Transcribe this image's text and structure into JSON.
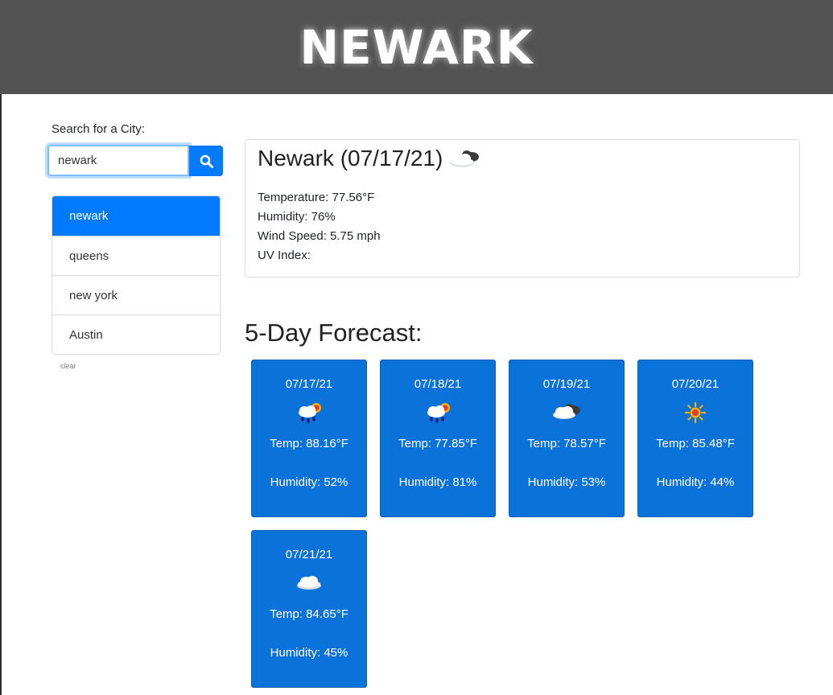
{
  "header": {
    "title": "NEWARK"
  },
  "search": {
    "label": "Search for a City:",
    "value": "newark",
    "button_icon": "search-icon"
  },
  "history": {
    "items": [
      {
        "label": "newark",
        "active": true
      },
      {
        "label": "queens",
        "active": false
      },
      {
        "label": "new york",
        "active": false
      },
      {
        "label": "Austin",
        "active": false
      }
    ],
    "clear_label": "clear"
  },
  "current": {
    "title": "Newark (07/17/21)",
    "icon": "partly-cloudy-icon",
    "temperature": "Temperature: 77.56°F",
    "humidity": "Humidity: 76%",
    "wind_speed": "Wind Speed: 5.75 mph",
    "uv_index": "UV Index:"
  },
  "forecast": {
    "heading": "5-Day Forecast:",
    "days": [
      {
        "date": "07/17/21",
        "icon": "rain-sun-icon",
        "temp": "Temp: 88.16°F",
        "humidity": "Humidity: 52%"
      },
      {
        "date": "07/18/21",
        "icon": "rain-sun-icon",
        "temp": "Temp: 77.85°F",
        "humidity": "Humidity: 81%"
      },
      {
        "date": "07/19/21",
        "icon": "partly-cloudy-icon",
        "temp": "Temp: 78.57°F",
        "humidity": "Humidity: 53%"
      },
      {
        "date": "07/20/21",
        "icon": "sun-icon",
        "temp": "Temp: 85.48°F",
        "humidity": "Humidity: 44%"
      },
      {
        "date": "07/21/21",
        "icon": "cloud-icon",
        "temp": "Temp: 84.65°F",
        "humidity": "Humidity: 45%"
      }
    ]
  },
  "colors": {
    "header_bg": "#525252",
    "accent": "#007bff",
    "card_bg": "#0b72d9"
  }
}
